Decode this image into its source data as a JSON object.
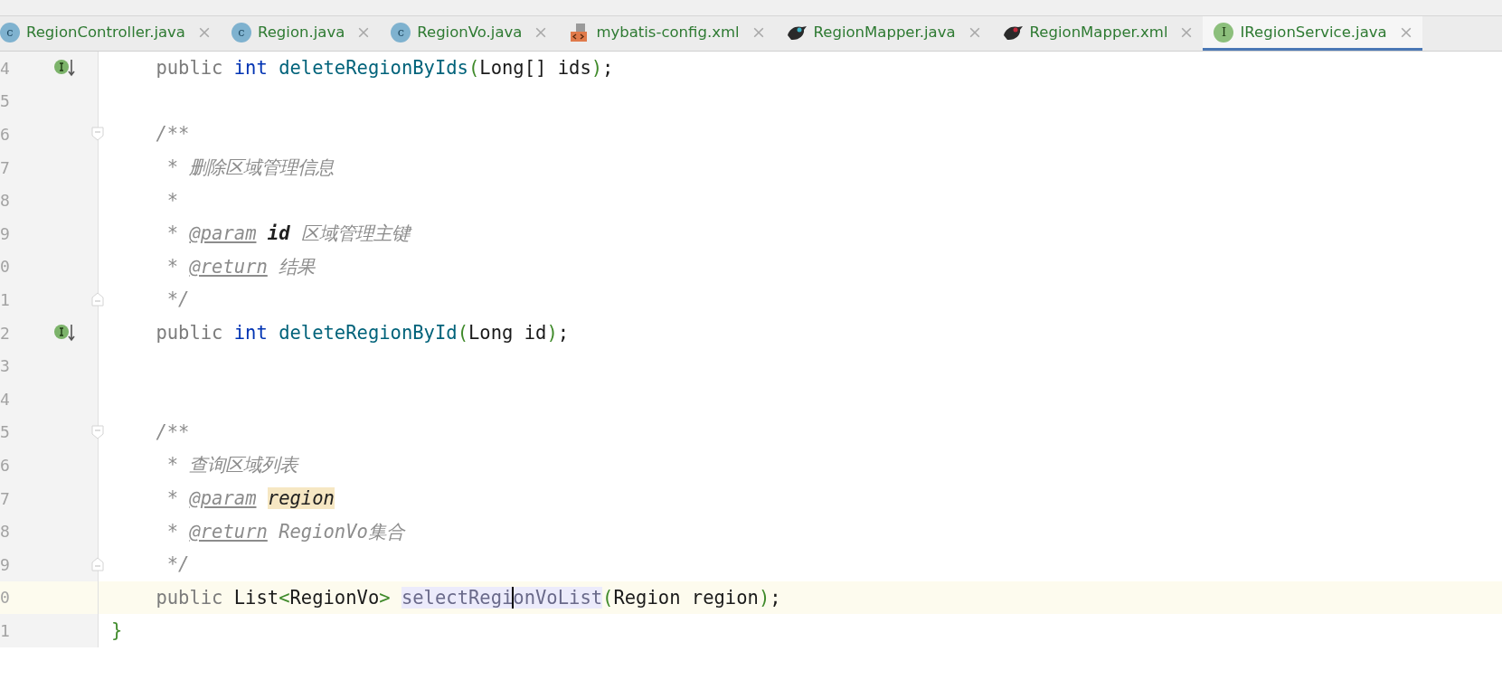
{
  "tabs": [
    {
      "label": "RegionController.java",
      "kind": "class",
      "icon_letter": "c",
      "selected": false
    },
    {
      "label": "Region.java",
      "kind": "class",
      "icon_letter": "c",
      "selected": false
    },
    {
      "label": "RegionVo.java",
      "kind": "class",
      "icon_letter": "c",
      "selected": false
    },
    {
      "label": "mybatis-config.xml",
      "kind": "xml",
      "selected": false
    },
    {
      "label": "RegionMapper.java",
      "kind": "mapper",
      "selected": false
    },
    {
      "label": "RegionMapper.xml",
      "kind": "mapper",
      "selected": false
    },
    {
      "label": "IRegionService.java",
      "kind": "interface",
      "icon_letter": "I",
      "selected": true
    }
  ],
  "editor": {
    "lines": [
      {
        "number": "4",
        "kind": "member",
        "implemented": true,
        "current": false,
        "tokens": [
          {
            "text": "public",
            "kind": "modifier"
          },
          {
            "text": "int",
            "kind": "keyword",
            "gap": true
          },
          {
            "text": "deleteRegionByIds",
            "kind": "method",
            "gap": true
          },
          {
            "text": "(",
            "kind": "paren"
          },
          {
            "text": "Long[] ids",
            "kind": "plain"
          },
          {
            "text": ")",
            "kind": "paren"
          },
          {
            "text": ";",
            "kind": "plain"
          }
        ]
      },
      {
        "number": "5",
        "kind": "blank",
        "current": false
      },
      {
        "number": "6",
        "kind": "member",
        "fold_start": true,
        "current": false,
        "tokens": [
          {
            "text": "/**",
            "kind": "comment"
          }
        ]
      },
      {
        "number": "7",
        "kind": "doc",
        "current": false,
        "tokens": [
          {
            "text": "* 删除区域管理信息",
            "kind": "comment"
          }
        ]
      },
      {
        "number": "8",
        "kind": "doc",
        "current": false,
        "tokens": [
          {
            "text": "*",
            "kind": "comment"
          }
        ]
      },
      {
        "number": "9",
        "kind": "doc",
        "current": false,
        "tokens": [
          {
            "text": "*",
            "kind": "comment"
          },
          {
            "text": "@param",
            "kind": "doc-tag",
            "gap": true
          },
          {
            "text": "id",
            "kind": "doc-param",
            "gap": true
          },
          {
            "text": "区域管理主键",
            "kind": "comment",
            "gap": true
          }
        ]
      },
      {
        "number": "0",
        "kind": "doc",
        "current": false,
        "tokens": [
          {
            "text": "*",
            "kind": "comment"
          },
          {
            "text": "@return",
            "kind": "doc-tag",
            "gap": true
          },
          {
            "text": "结果",
            "kind": "comment",
            "gap": true
          }
        ]
      },
      {
        "number": "1",
        "kind": "doc",
        "fold_end": true,
        "current": false,
        "tokens": [
          {
            "text": "*/",
            "kind": "comment"
          }
        ]
      },
      {
        "number": "2",
        "kind": "member",
        "implemented": true,
        "current": false,
        "tokens": [
          {
            "text": "public",
            "kind": "modifier"
          },
          {
            "text": "int",
            "kind": "keyword",
            "gap": true
          },
          {
            "text": "deleteRegionById",
            "kind": "method",
            "gap": true
          },
          {
            "text": "(",
            "kind": "paren"
          },
          {
            "text": "Long id",
            "kind": "plain"
          },
          {
            "text": ")",
            "kind": "paren"
          },
          {
            "text": ";",
            "kind": "plain"
          }
        ]
      },
      {
        "number": "3",
        "kind": "blank",
        "current": false
      },
      {
        "number": "4",
        "kind": "blank",
        "current": false
      },
      {
        "number": "5",
        "kind": "member",
        "fold_start": true,
        "current": false,
        "tokens": [
          {
            "text": "/**",
            "kind": "comment"
          }
        ]
      },
      {
        "number": "6",
        "kind": "doc",
        "current": false,
        "tokens": [
          {
            "text": "* 查询区域列表",
            "kind": "comment"
          }
        ]
      },
      {
        "number": "7",
        "kind": "doc",
        "current": false,
        "tokens": [
          {
            "text": "*",
            "kind": "comment"
          },
          {
            "text": "@param",
            "kind": "doc-tag",
            "gap": true
          },
          {
            "text": "region",
            "kind": "doc-param-highlight",
            "gap": true
          }
        ]
      },
      {
        "number": "8",
        "kind": "doc",
        "current": false,
        "tokens": [
          {
            "text": "*",
            "kind": "comment"
          },
          {
            "text": "@return",
            "kind": "doc-tag",
            "gap": true
          },
          {
            "text": "RegionVo集合",
            "kind": "comment",
            "gap": true
          }
        ]
      },
      {
        "number": "9",
        "kind": "doc",
        "fold_end": true,
        "current": false,
        "tokens": [
          {
            "text": "*/",
            "kind": "comment"
          }
        ]
      },
      {
        "number": "0",
        "kind": "member",
        "current": true,
        "tokens": [
          {
            "text": "public",
            "kind": "modifier"
          },
          {
            "text": "List",
            "kind": "plain",
            "gap": true
          },
          {
            "text": "<",
            "kind": "paren"
          },
          {
            "text": "RegionVo",
            "kind": "plain"
          },
          {
            "text": ">",
            "kind": "paren"
          },
          {
            "text": "selectRegi",
            "kind": "method-usage",
            "gap": true
          },
          {
            "text": "onVoList",
            "kind": "method-usage",
            "caret_before": true
          },
          {
            "text": "(",
            "kind": "paren"
          },
          {
            "text": "Region region",
            "kind": "plain"
          },
          {
            "text": ")",
            "kind": "paren"
          },
          {
            "text": ";",
            "kind": "plain"
          }
        ]
      },
      {
        "number": "1",
        "kind": "class-end",
        "current": false,
        "tokens": [
          {
            "text": "}",
            "kind": "paren"
          }
        ]
      }
    ]
  }
}
